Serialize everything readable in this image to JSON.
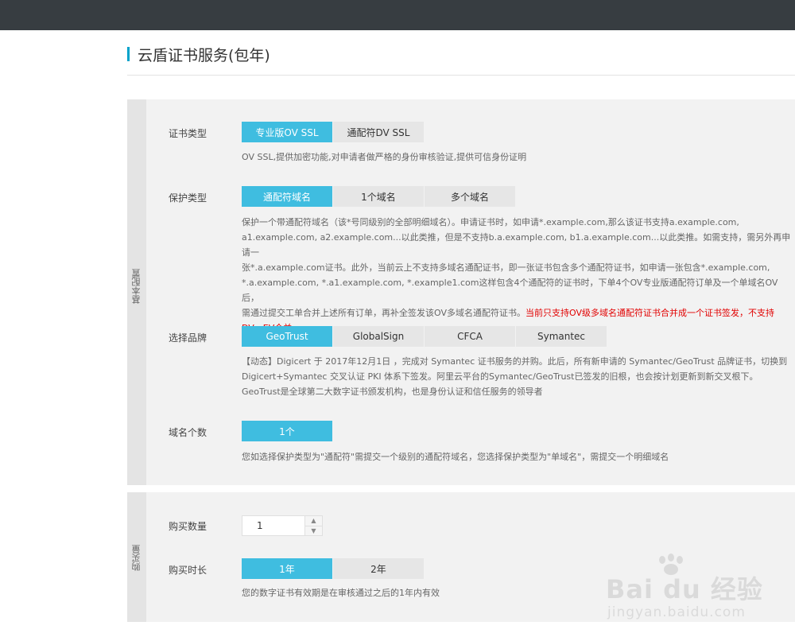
{
  "page": {
    "title": "云盾证书服务(包年)"
  },
  "basic_section": {
    "side_label": "基本配置",
    "cert_type": {
      "label": "证书类型",
      "options": [
        "专业版OV SSL",
        "通配符DV SSL"
      ],
      "selected": "专业版OV SSL",
      "desc": "OV SSL,提供加密功能,对申请者做严格的身份审核验证,提供可信身份证明"
    },
    "protect_type": {
      "label": "保护类型",
      "options": [
        "通配符域名",
        "1个域名",
        "多个域名"
      ],
      "selected": "通配符域名",
      "desc_lines": [
        "保护一个带通配符域名（该*号同级别的全部明细域名）。申请证书时，如申请*.example.com,那么该证书支持a.example.com,",
        "a1.example.com, a2.example.com...以此类推，但是不支持b.a.example.com, b1.a.example.com...以此类推。如需支持，需另外再申请一",
        "张*.a.example.com证书。此外，当前云上不支持多域名通配证书，即一张证书包含多个通配符证书，如申请一张包含*.example.com,",
        "*.a.example.com, *.a1.example.com, *.example1.com这样包含4个通配符的证书时，下单4个OV专业版通配符订单及一个单域名OV后，"
      ],
      "desc_last_plain": "需通过提交工单合并上述所有订单，再补全签发该OV多域名通配符证书。",
      "desc_red_1": "当前只支持OV级多域名通配符证书合并成一个证书签发，不支持",
      "desc_red_2": "DV、EV合并"
    },
    "brand": {
      "label": "选择品牌",
      "options": [
        "GeoTrust",
        "GlobalSign",
        "CFCA",
        "Symantec"
      ],
      "selected": "GeoTrust",
      "desc_lines": [
        "【动态】Digicert 于 2017年12月1日 ，完成对 Symantec 证书服务的并购。此后，所有新申请的 Symantec/GeoTrust 品牌证书，切换到",
        "Digicert+Symantec 交叉认证 PKI 体系下签发。阿里云平台的Symantec/GeoTrust已签发的旧根，也会按计划更新到新交叉根下。",
        "GeoTrust是全球第二大数字证书颁发机构，也是身份认证和信任服务的领导者"
      ]
    },
    "domain_count": {
      "label": "域名个数",
      "options": [
        "1个"
      ],
      "selected": "1个",
      "desc": "您如选择保护类型为\"通配符\"需提交一个级别的通配符域名，您选择保护类型为\"单域名\"，需提交一个明细域名"
    }
  },
  "purchase_section": {
    "side_label": "购买量",
    "quantity": {
      "label": "购买数量",
      "value": "1"
    },
    "duration": {
      "label": "购买时长",
      "options": [
        "1年",
        "2年"
      ],
      "selected": "1年",
      "desc": "您的数字证书有效期是在审核通过之后的1年内有效"
    }
  },
  "watermark": {
    "logo": "Bai du 经验",
    "url": "jingyan.baidu.com"
  },
  "colors": {
    "accent": "#3fbde0",
    "topbar": "#373d41",
    "warning": "#e10000",
    "title_bar": "#00a2ca"
  }
}
